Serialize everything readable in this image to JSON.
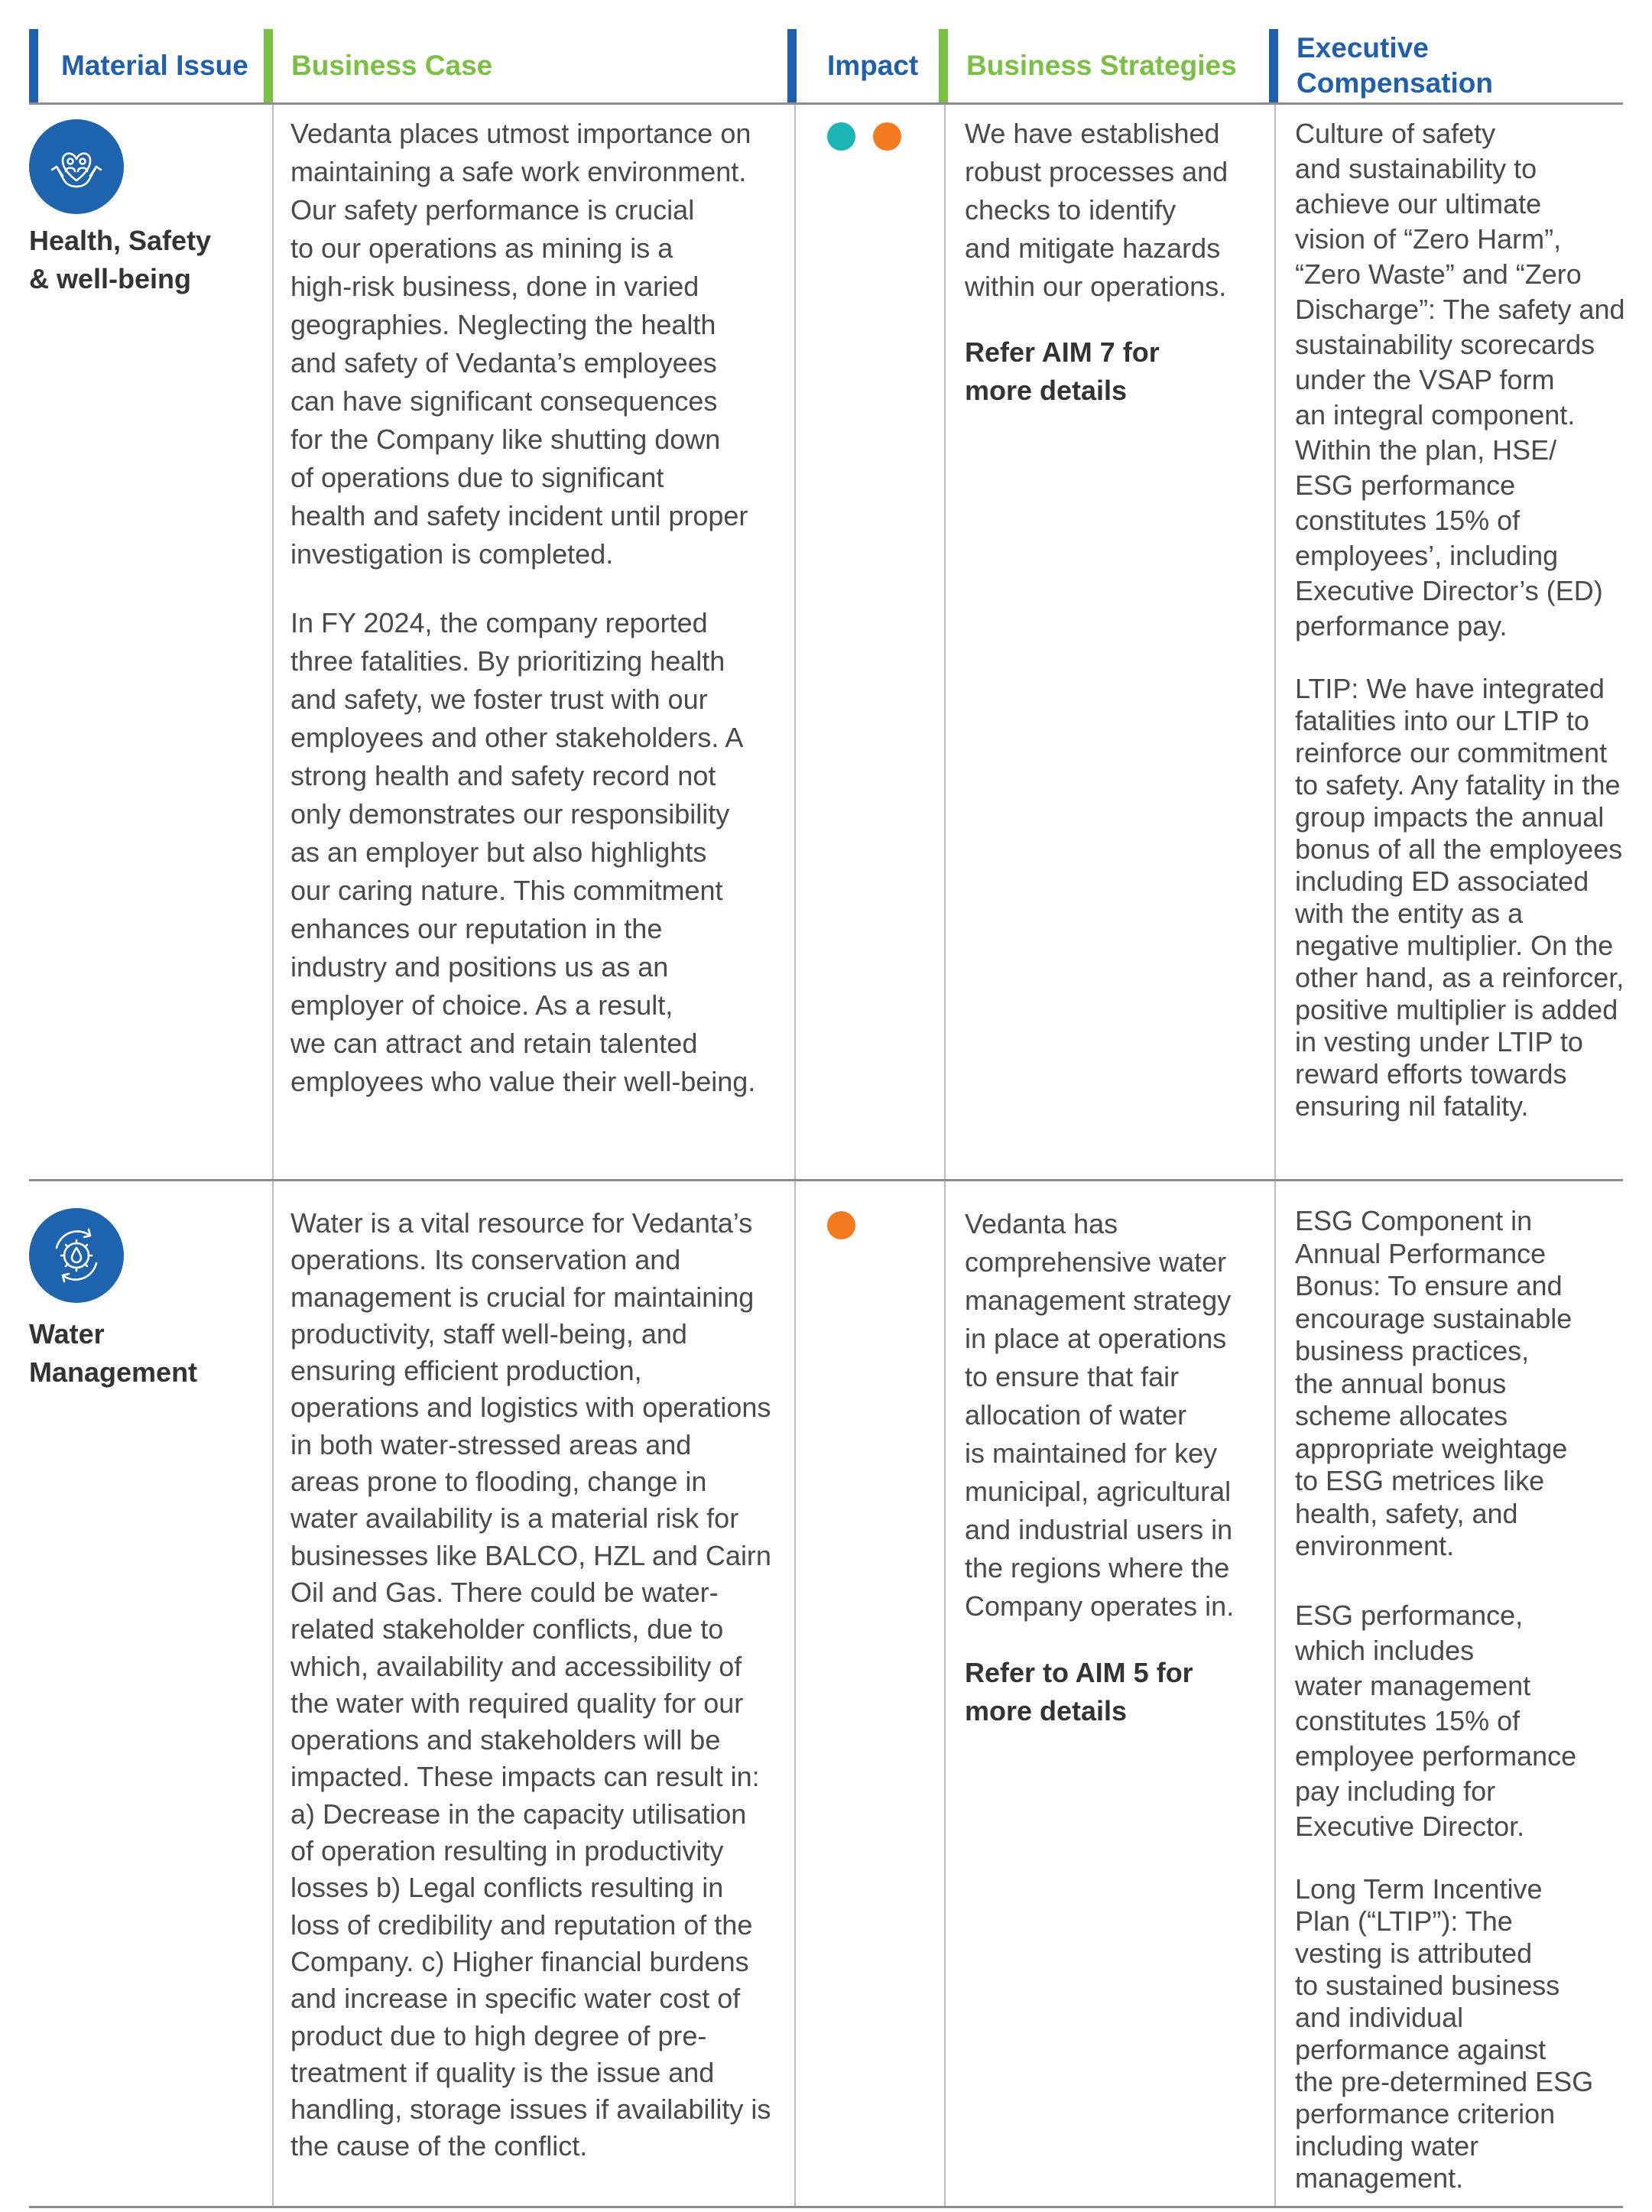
{
  "header": {
    "material_issue": "Material Issue",
    "business_case": "Business Case",
    "impact": "Impact",
    "business_strategies": "Business Strategies",
    "executive_compensation": "Executive\nCompensation"
  },
  "colors": {
    "blue": "#1f5fae",
    "green": "#7ac143",
    "impact_teal": "#1bb5b5",
    "impact_orange": "#f47a20"
  },
  "rows": [
    {
      "icon": "hands-holding-people-heart-icon",
      "issue": "Health, Safety\n& well-being",
      "business_case": [
        "Vedanta places utmost importance on\nmaintaining a safe work environment.\nOur safety performance is crucial\nto our operations as mining is a\nhigh-risk business, done in varied\ngeographies. Neglecting the health\nand safety of Vedanta’s employees\ncan have significant consequences\nfor the Company like shutting down\nof operations due to significant\nhealth and safety incident until proper\ninvestigation is completed.",
        "In FY 2024, the company reported\nthree fatalities. By prioritizing health\nand safety, we foster trust with our\nemployees and other stakeholders. A\nstrong health and safety record not\nonly demonstrates our responsibility\nas an employer but also highlights\nour caring nature. This commitment\nenhances our reputation in the\nindustry and positions us as an\nemployer of choice. As a result,\nwe can attract and retain talented\nemployees who value their well-being."
      ],
      "impact": [
        "teal",
        "orange"
      ],
      "strategy": "We have established\nrobust processes and\nchecks to identify\nand mitigate hazards\nwithin our operations.",
      "reference": "Refer AIM 7 for\nmore details",
      "executive_compensation": [
        "Culture of safety\nand sustainability to\nachieve our ultimate\nvision of “Zero Harm”,\n“Zero Waste” and “Zero\nDischarge”: The safety and\nsustainability scorecards\nunder the VSAP form\nan integral component.\nWithin the plan, HSE/\nESG performance\nconstitutes 15% of\nemployees’, including\nExecutive Director’s (ED)\nperformance pay.",
        "LTIP: We have integrated\nfatalities into our LTIP to\nreinforce our commitment\nto safety. Any fatality in the\ngroup impacts the annual\nbonus of all the employees\nincluding ED associated\nwith the entity as a\nnegative multiplier. On the\nother hand, as a reinforcer,\npositive multiplier is added\nin vesting under LTIP to\nreward efforts towards\nensuring nil fatality."
      ]
    },
    {
      "icon": "gear-water-drop-cycle-icon",
      "issue": "Water\nManagement",
      "business_case": [
        "Water is a vital resource for Vedanta’s\noperations. Its conservation and\nmanagement is crucial for maintaining\nproductivity, staff well-being, and\nensuring efficient production,\noperations and logistics with operations\nin both water-stressed areas and\nareas prone to flooding, change in\nwater availability is a material risk for\nbusinesses like BALCO, HZL and Cairn\nOil and Gas. There could be water-\nrelated stakeholder conflicts, due to\nwhich, availability and accessibility of\nthe water with required quality for our\noperations and stakeholders will be\nimpacted. These impacts can result in:\na) Decrease in the capacity utilisation\nof operation resulting in productivity\nlosses b) Legal conflicts resulting in\nloss of credibility and reputation of the\nCompany. c) Higher financial burdens\nand increase in specific water cost of\nproduct due to high degree of pre-\ntreatment if quality is the issue and\nhandling, storage issues if availability is\nthe cause of the conflict."
      ],
      "impact": [
        "orange"
      ],
      "strategy": "Vedanta has\ncomprehensive water\nmanagement strategy\nin place at operations\nto ensure that fair\nallocation of water\nis maintained for key\nmunicipal, agricultural\nand industrial users in\nthe regions where the\nCompany operates in.",
      "reference": "Refer to AIM 5 for\nmore details",
      "executive_compensation": [
        "ESG Component in\nAnnual Performance\nBonus: To ensure and\nencourage sustainable\nbusiness practices,\nthe annual bonus\nscheme allocates\nappropriate weightage\nto ESG metrices like\nhealth, safety, and\nenvironment.",
        "ESG performance,\nwhich includes\nwater management\nconstitutes 15% of\nemployee performance\npay including for\nExecutive Director.",
        "Long Term Incentive\nPlan (“LTIP”): The\nvesting is attributed\nto sustained business\nand individual\nperformance against\nthe pre-determined ESG\nperformance criterion\nincluding water\nmanagement."
      ]
    }
  ]
}
